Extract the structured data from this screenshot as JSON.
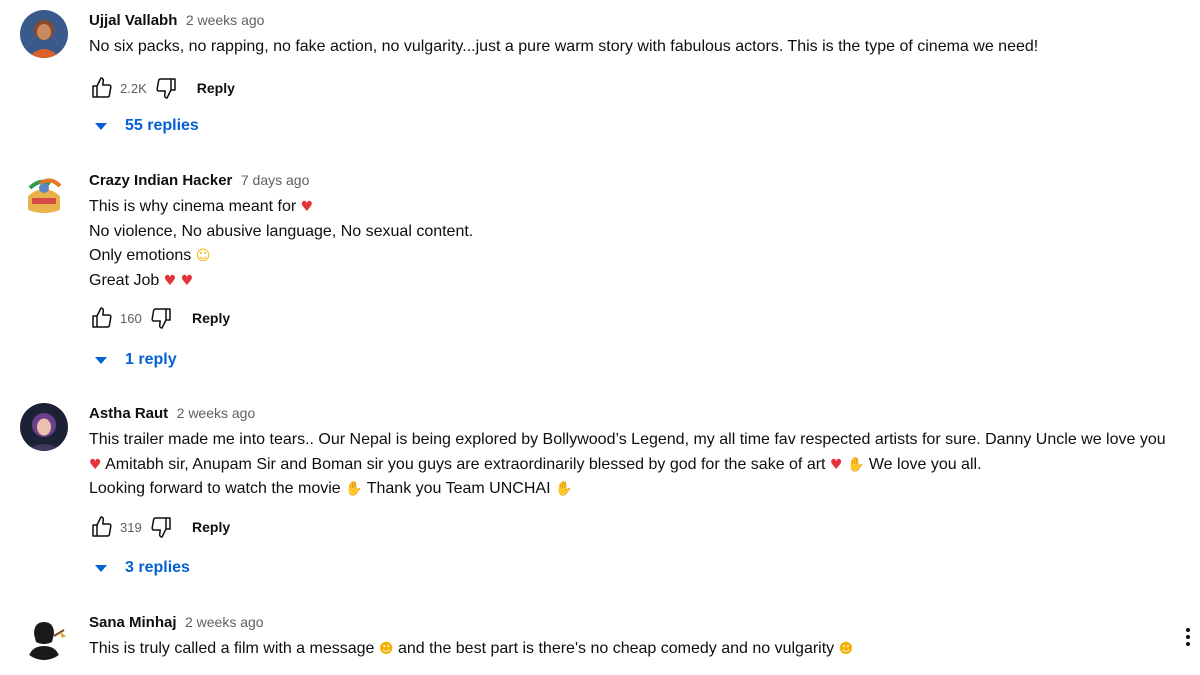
{
  "comments": [
    {
      "author": "Ujjal Vallabh",
      "time": "2 weeks ago",
      "lines": [
        "No six packs, no rapping, no fake action, no vulgarity...just a pure warm story with fabulous actors. This is the type of cinema we need!"
      ],
      "likes": "2.2K",
      "reply_label": "Reply",
      "replies_label": "55 replies"
    },
    {
      "author": "Crazy Indian Hacker",
      "time": "7 days ago",
      "lines": [
        "This is why cinema meant for",
        "No violence, No abusive language, No sexual content.",
        "Only emotions",
        "Great Job"
      ],
      "likes": "160",
      "reply_label": "Reply",
      "replies_label": "1 reply"
    },
    {
      "author": "Astha Raut",
      "time": "2 weeks ago",
      "lines": [
        "This trailer made me into tears.. Our Nepal is being explored by Bollywood’s Legend, my all time fav respected artists for sure. Danny Uncle we love you",
        "Amitabh sir, Anupam Sir and Boman sir you guys are extraordinarily blessed by god for the sake of art",
        "We love you all.",
        "Looking forward to watch the movie",
        "Thank you Team UNCHAI"
      ],
      "likes": "319",
      "reply_label": "Reply",
      "replies_label": "3 replies"
    },
    {
      "author": "Sana Minhaj",
      "time": "2 weeks ago",
      "lines": [
        "This is truly called a film with a message",
        "and the best part is there's no cheap comedy and no vulgarity"
      ]
    }
  ],
  "icons": {
    "like": "thumbs-up-icon",
    "dislike": "thumbs-down-icon",
    "expand": "caret-down-icon",
    "more": "more-vert-icon",
    "heart": "red-heart-emoji",
    "smile": "smiling-face-emoji",
    "pray": "folded-hands-emoji",
    "heart_eyes": "heart-eyes-emoji",
    "hearts_face": "smiling-face-with-hearts-emoji"
  },
  "colors": {
    "link_blue": "#065fd4",
    "secondary_text": "#606060",
    "primary_text": "#0f0f0f"
  }
}
